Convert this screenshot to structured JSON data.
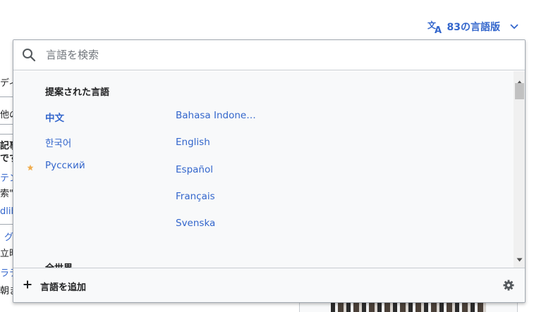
{
  "language_button": {
    "label": "83の言語版",
    "icon": "translate-icon"
  },
  "background_fragments": [
    "ディ",
    "他の",
    "記事",
    "です",
    "テン",
    "索\"",
    "dlib",
    "グ",
    "立時",
    "ラテ",
    "朝ま"
  ],
  "search": {
    "placeholder": "言語を検索",
    "value": ""
  },
  "suggested": {
    "title": "提案された言語",
    "left_column": [
      {
        "label": "中文",
        "active": true,
        "starred": false
      },
      {
        "label": "한국어",
        "active": false,
        "starred": false
      },
      {
        "label": "Русский",
        "active": false,
        "starred": true
      }
    ],
    "right_column": [
      {
        "label": "Bahasa Indone…"
      },
      {
        "label": "English"
      },
      {
        "label": "Español"
      },
      {
        "label": "Français"
      },
      {
        "label": "Svenska"
      }
    ]
  },
  "next_section_title": "全世界",
  "footer": {
    "add_language_label": "言語を追加"
  },
  "colors": {
    "link": "#3366cc",
    "star": "#f0ad4e",
    "border": "#a2a9b1",
    "panel_bg": "#f8f9fa"
  }
}
